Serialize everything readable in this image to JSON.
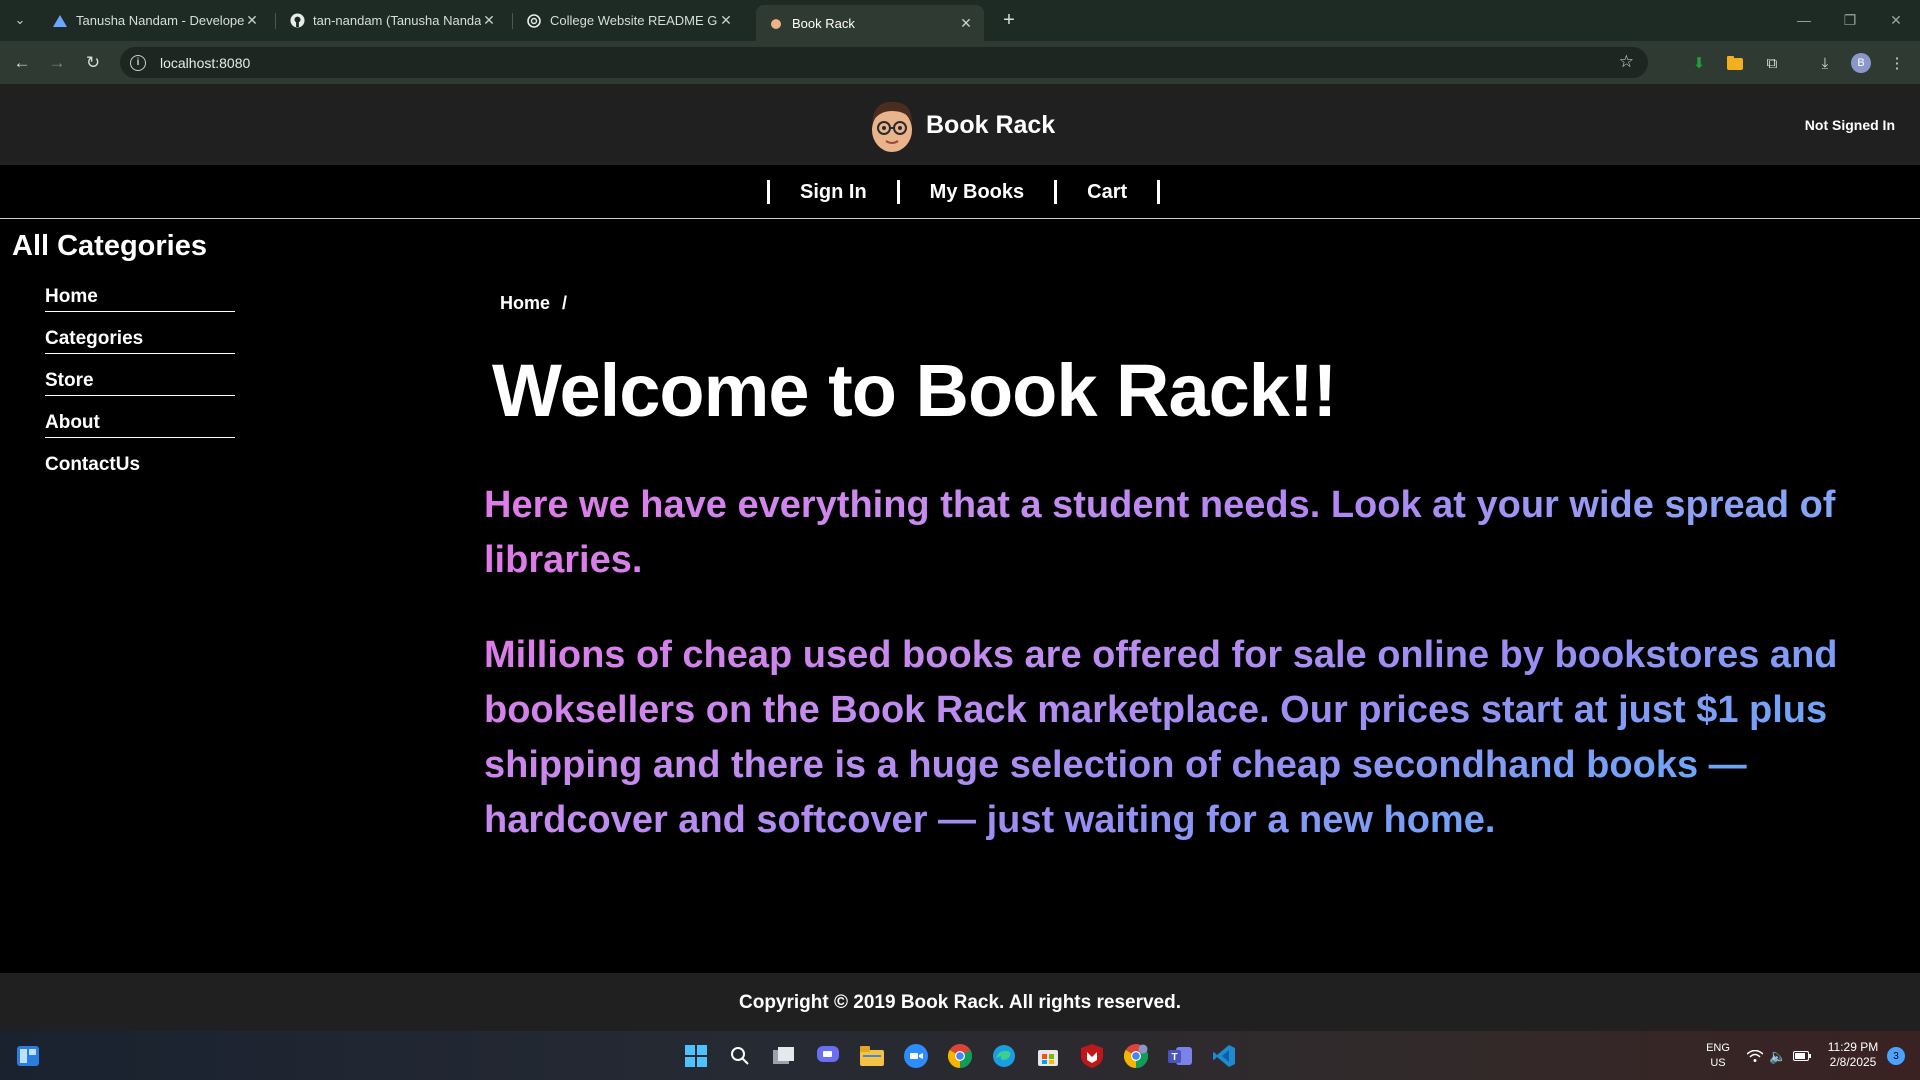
{
  "browser": {
    "tabs": [
      {
        "title": "Tanusha Nandam - Developer P",
        "icon": "triangle-logo-icon"
      },
      {
        "title": "tan-nandam (Tanusha Nandam)",
        "icon": "github-icon"
      },
      {
        "title": "College Website README Guid",
        "icon": "chatgpt-icon"
      },
      {
        "title": "Book Rack",
        "icon": "book-rack-favicon"
      }
    ],
    "url": "localhost:8080"
  },
  "header": {
    "brand": "Book Rack",
    "status": "Not Signed In"
  },
  "nav": {
    "items": [
      "Sign In",
      "My Books",
      "Cart"
    ]
  },
  "sidebar": {
    "title": "All Categories",
    "items": [
      "Home",
      "Categories",
      "Store",
      "About",
      "ContactUs"
    ]
  },
  "main": {
    "breadcrumb": "Home",
    "breadcrumb_sep": "/",
    "headline": "Welcome to Book Rack!!",
    "paragraph1": "Here we have everything that a student needs. Look at your wide spread of libraries.",
    "paragraph2": "Millions of cheap used books are offered for sale online by bookstores and booksellers on the Book Rack marketplace. Our prices start at just $1 plus shipping and there is a huge selection of cheap secondhand books — hardcover and softcover — just waiting for a new home."
  },
  "footer": {
    "copyright": "Copyright © 2019 Book Rack. All rights reserved."
  },
  "taskbar": {
    "lang": "ENG",
    "region": "US",
    "time": "11:29 PM",
    "date": "2/8/2025",
    "notifications": "3"
  },
  "colors": {
    "header_bg": "#202020",
    "page_bg": "#000000",
    "gradient_pink": "#e07ae8",
    "gradient_blue": "#4a9bf5"
  }
}
